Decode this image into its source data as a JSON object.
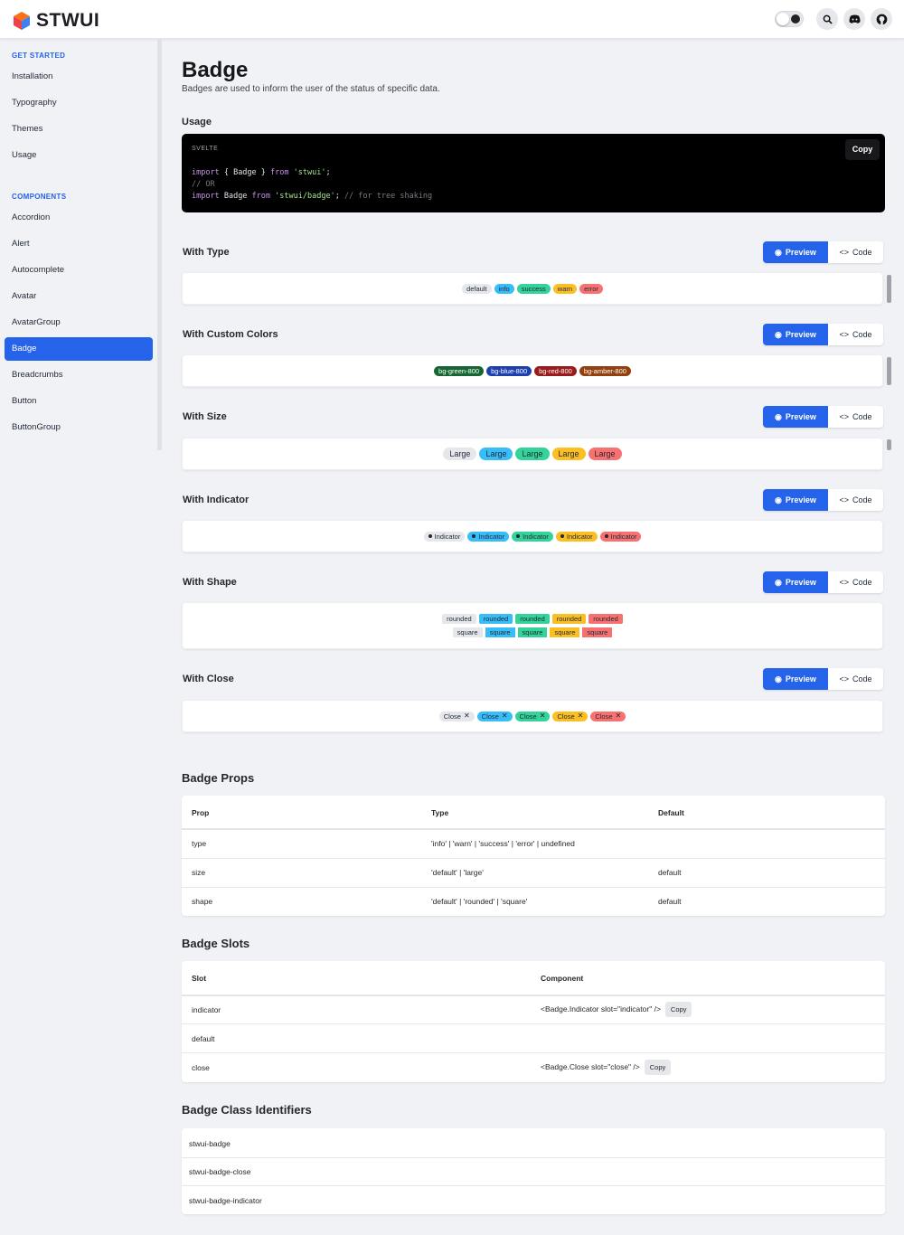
{
  "header": {
    "brand": "STWUI",
    "icons": [
      "theme-toggle-icon",
      "search-icon",
      "discord-icon",
      "github-icon"
    ]
  },
  "sidebar": {
    "sections": [
      {
        "title": "GET STARTED",
        "items": [
          "Installation",
          "Typography",
          "Themes",
          "Usage"
        ]
      },
      {
        "title": "COMPONENTS",
        "items": [
          "Accordion",
          "Alert",
          "Autocomplete",
          "Avatar",
          "AvatarGroup",
          "Badge",
          "Breadcrumbs",
          "Button",
          "ButtonGroup"
        ]
      }
    ],
    "active": "Badge"
  },
  "page": {
    "title": "Badge",
    "subtitle": "Badges are used to inform the user of the status of specific data."
  },
  "usage": {
    "heading": "Usage",
    "lang": "SVELTE",
    "copy": "Copy",
    "line1": {
      "a": "import",
      "b": " { Badge } ",
      "c": "from",
      "d": " 'stwui'",
      "e": ";"
    },
    "line2": "// OR",
    "line3": {
      "a": "import",
      "b": " Badge ",
      "c": "from",
      "d": " 'stwui/badge'",
      "e": "; ",
      "f": "// for tree shaking"
    }
  },
  "buttons": {
    "preview": "Preview",
    "code": "Code"
  },
  "examples": {
    "type": {
      "heading": "With Type",
      "badges": [
        "default",
        "info",
        "success",
        "warn",
        "error"
      ]
    },
    "custom": {
      "heading": "With Custom Colors",
      "badges": [
        "bg-green-800",
        "bg-blue-800",
        "bg-red-800",
        "bg-amber-800"
      ]
    },
    "size": {
      "heading": "With Size",
      "badges": [
        "Large",
        "Large",
        "Large",
        "Large",
        "Large"
      ]
    },
    "indicator": {
      "heading": "With Indicator",
      "badges": [
        "Indicator",
        "Indicator",
        "Indicator",
        "Indicator",
        "Indicator"
      ]
    },
    "shape": {
      "heading": "With Shape",
      "rounded": [
        "rounded",
        "rounded",
        "rounded",
        "rounded",
        "rounded"
      ],
      "square": [
        "square",
        "square",
        "square",
        "square",
        "square"
      ]
    },
    "close": {
      "heading": "With Close",
      "badges": [
        "Close",
        "Close",
        "Close",
        "Close",
        "Close"
      ],
      "x": "✕"
    }
  },
  "props": {
    "heading": "Badge Props",
    "cols": [
      "Prop",
      "Type",
      "Default"
    ],
    "rows": [
      [
        "type",
        "'info' | 'warn' | 'success' | 'error' | undefined",
        ""
      ],
      [
        "size",
        "'default' | 'large'",
        "default"
      ],
      [
        "shape",
        "'default' | 'rounded' | 'square'",
        "default"
      ]
    ]
  },
  "slots": {
    "heading": "Badge Slots",
    "cols": [
      "Slot",
      "Component"
    ],
    "rows": [
      [
        "indicator",
        "<Badge.Indicator slot=\"indicator\" />",
        "Copy"
      ],
      [
        "default",
        "",
        ""
      ],
      [
        "close",
        "<Badge.Close slot=\"close\" />",
        "Copy"
      ]
    ]
  },
  "classes": {
    "heading": "Badge Class Identifiers",
    "rows": [
      "stwui-badge",
      "stwui-badge-close",
      "stwui-badge-indicator"
    ]
  },
  "colors": {
    "accent": "#2563eb",
    "info": "#38bdf8",
    "success": "#34d399",
    "warn": "#fbbf24",
    "error": "#f87171"
  }
}
